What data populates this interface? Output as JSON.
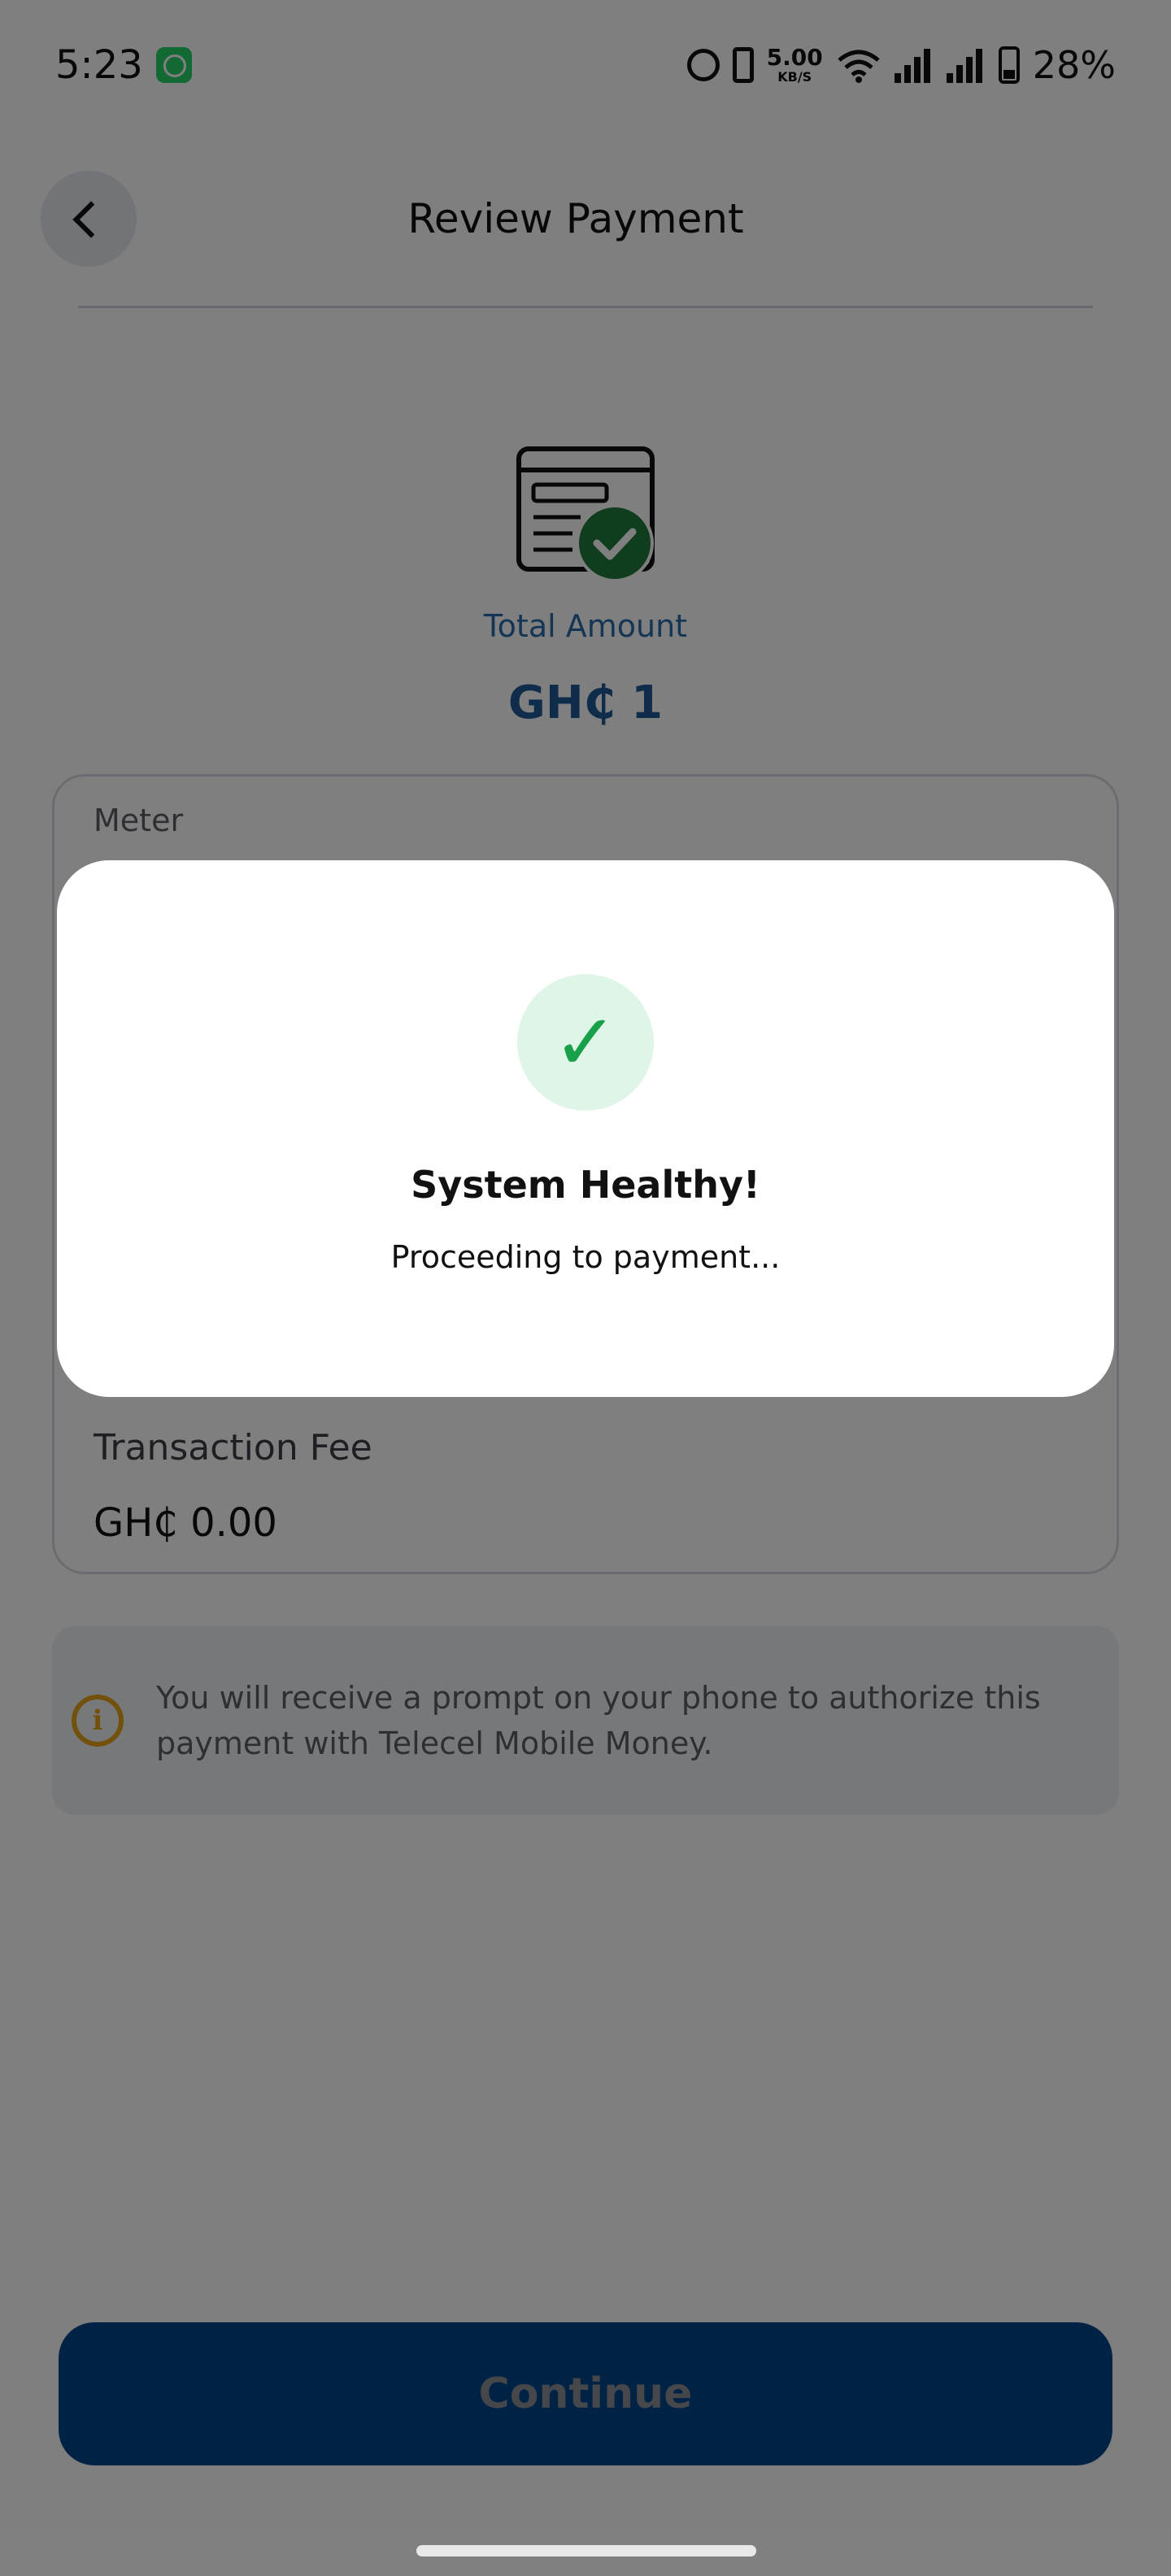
{
  "status_bar": {
    "time": "5:23",
    "network_speed": "5.00",
    "network_speed_unit": "KB/S",
    "battery": "28%",
    "icons": [
      "whatsapp-icon",
      "alarm-icon",
      "vibrate-icon",
      "wifi-icon",
      "signal-icon",
      "signal-icon",
      "battery-icon"
    ]
  },
  "header": {
    "title": "Review Payment",
    "back_icon": "chevron-left-icon"
  },
  "summary": {
    "icon": "receipt-check-icon",
    "total_label": "Total Amount",
    "total_value": "GH₵ 1"
  },
  "details": {
    "meter_label": "Meter",
    "fee_label": "Transaction Fee",
    "fee_value": "GH₵ 0.00"
  },
  "info": {
    "icon": "info-icon",
    "icon_glyph": "i",
    "text": "You will receive a prompt on your phone to authorize this payment with Telecel Mobile Money."
  },
  "actions": {
    "continue_label": "Continue"
  },
  "dialog": {
    "icon": "checkmark-icon",
    "icon_glyph": "✓",
    "title": "System Healthy!",
    "message": "Proceeding to payment..."
  },
  "colors": {
    "primary": "#00478a",
    "accent_text": "#1e5a94",
    "success": "#18a04a",
    "success_bg": "#dff5e7",
    "warning": "#e5a219"
  }
}
